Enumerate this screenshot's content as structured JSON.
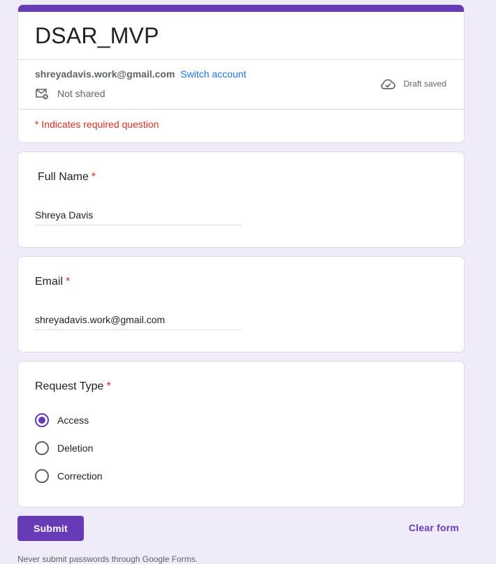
{
  "form": {
    "title": "DSAR_MVP",
    "accent_color": "#673ab7",
    "background_color": "#f0ebf8"
  },
  "account": {
    "email": "shreyadavis.work@gmail.com",
    "switch_label": "Switch account",
    "sharing_status": "Not shared",
    "sharing_icon": "mail-x-icon",
    "draft_status": "Draft saved",
    "draft_icon": "cloud-check-icon"
  },
  "required_note": "* Indicates required question",
  "questions": [
    {
      "label": "Full Name",
      "required_mark": "*",
      "answer": "Shreya Davis"
    },
    {
      "label": "Email",
      "required_mark": "*",
      "answer": "shreyadavis.work@gmail.com"
    },
    {
      "label": "Request Type",
      "required_mark": "*",
      "options": [
        "Access",
        "Deletion",
        "Correction"
      ],
      "selected": "Access"
    }
  ],
  "footer": {
    "submit_label": "Submit",
    "clear_label": "Clear form",
    "note": "Never submit passwords through Google Forms."
  }
}
